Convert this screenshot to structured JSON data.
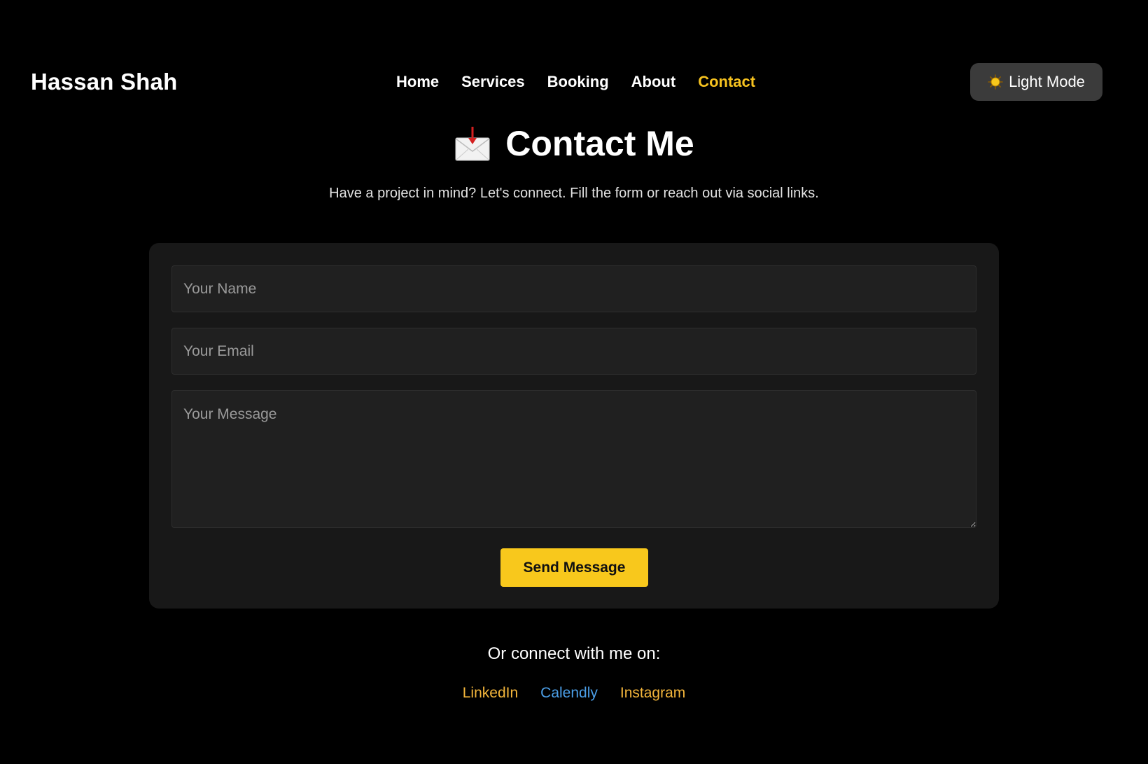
{
  "header": {
    "brand": "Hassan Shah",
    "nav": [
      {
        "label": "Home"
      },
      {
        "label": "Services"
      },
      {
        "label": "Booking"
      },
      {
        "label": "About"
      },
      {
        "label": "Contact",
        "active": true
      }
    ],
    "mode_toggle": {
      "icon": "sun-icon",
      "label": "Light Mode"
    }
  },
  "main": {
    "heading_icon": "envelope-with-arrow-icon",
    "title": "Contact Me",
    "subtitle": "Have a project in mind? Let's connect. Fill the form or reach out via social links."
  },
  "form": {
    "name_placeholder": "Your Name",
    "email_placeholder": "Your Email",
    "message_placeholder": "Your Message",
    "submit_label": "Send Message"
  },
  "footer": {
    "connect_text": "Or connect with me on:",
    "links": [
      {
        "label": "LinkedIn"
      },
      {
        "label": "Calendly"
      },
      {
        "label": "Instagram"
      }
    ]
  },
  "colors": {
    "background": "#000000",
    "accent": "#f8c81c",
    "card": "#181818",
    "calendly_link": "#4b9fe8",
    "link": "#f4b63b"
  }
}
